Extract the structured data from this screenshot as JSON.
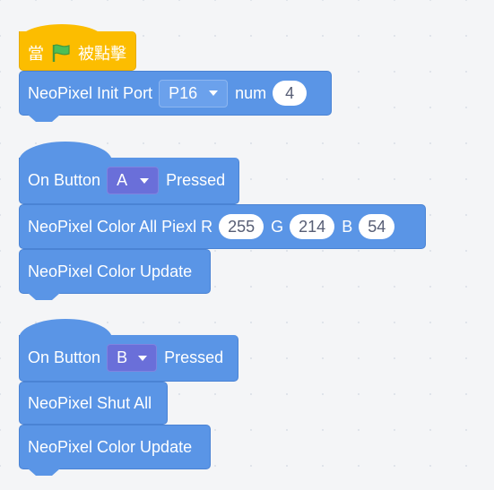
{
  "hat_when_flag": {
    "prefix": "當",
    "flag_icon": "green-flag-icon",
    "suffix": "被點擊"
  },
  "init_block": {
    "label": "NeoPixel Init Port",
    "port_value": "P16",
    "num_label": "num",
    "num_value": "4"
  },
  "button_a_hat": {
    "label_prefix": "On Button",
    "button_value": "A",
    "label_suffix": "Pressed"
  },
  "color_all_block": {
    "label": "NeoPixel Color All Piexl R",
    "r_value": "255",
    "g_label": "G",
    "g_value": "214",
    "b_label": "B",
    "b_value": "54"
  },
  "update_block_1": {
    "label": "NeoPixel Color Update"
  },
  "button_b_hat": {
    "label_prefix": "On Button",
    "button_value": "B",
    "label_suffix": "Pressed"
  },
  "shut_all_block": {
    "label": "NeoPixel Shut All"
  },
  "update_block_2": {
    "label": "NeoPixel Color Update"
  },
  "colors": {
    "event_block": "#fcbd00",
    "neopixel_block": "#5a95e6",
    "dropdown_dark": "#6a6fd9",
    "flag_green": "#4cbf56"
  }
}
